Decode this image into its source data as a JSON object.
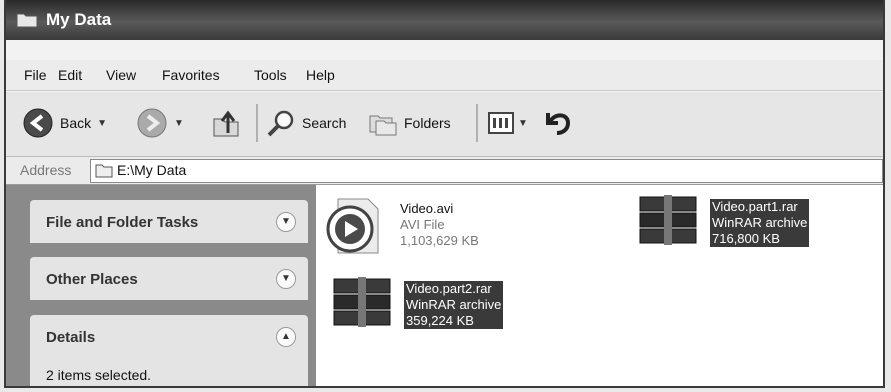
{
  "window": {
    "title": "My Data"
  },
  "menu": [
    "File",
    "Edit",
    "View",
    "Favorites",
    "Tools",
    "Help"
  ],
  "toolbar": {
    "back_label": "Back",
    "search_label": "Search",
    "folders_label": "Folders"
  },
  "address": {
    "label": "Address",
    "value": "E:\\My Data"
  },
  "sidebar": {
    "panels": [
      {
        "title": "File and Folder Tasks",
        "expanded": false
      },
      {
        "title": "Other Places",
        "expanded": false
      },
      {
        "title": "Details",
        "expanded": true,
        "body": "2 items selected."
      }
    ]
  },
  "files": [
    {
      "name": "Video.avi",
      "type": "AVI File",
      "size": "1,103,629 KB",
      "selected": false,
      "icon": "media-player-icon"
    },
    {
      "name": "Video.part1.rar",
      "type": "WinRAR archive",
      "size": "716,800 KB",
      "selected": true,
      "icon": "winrar-archive-icon"
    },
    {
      "name": "Video.part2.rar",
      "type": "WinRAR archive",
      "size": "359,224 KB",
      "selected": true,
      "icon": "winrar-archive-icon"
    }
  ]
}
